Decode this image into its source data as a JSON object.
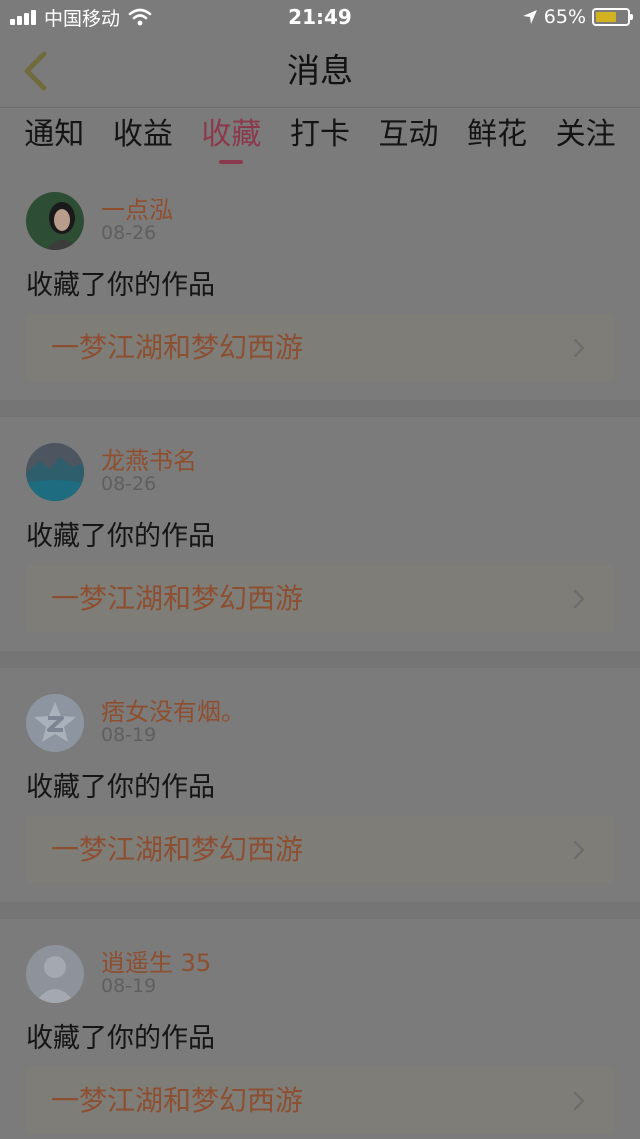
{
  "status_bar": {
    "carrier": "中国移动",
    "time": "21:49",
    "battery": "65%"
  },
  "nav": {
    "title": "消息"
  },
  "tabs": [
    {
      "label": "通知",
      "active": false
    },
    {
      "label": "收益",
      "active": false
    },
    {
      "label": "收藏",
      "active": true
    },
    {
      "label": "打卡",
      "active": false
    },
    {
      "label": "互动",
      "active": false
    },
    {
      "label": "鲜花",
      "active": false
    },
    {
      "label": "关注",
      "active": false
    }
  ],
  "items": [
    {
      "user": "一点泓",
      "date": "08-26",
      "action": "收藏了你的作品",
      "work": "一梦江湖和梦幻西游"
    },
    {
      "user": "龙燕书名",
      "date": "08-26",
      "action": "收藏了你的作品",
      "work": "一梦江湖和梦幻西游"
    },
    {
      "user": "痞女没有烟。",
      "date": "08-19",
      "action": "收藏了你的作品",
      "work": "一梦江湖和梦幻西游"
    },
    {
      "user": "逍遥生 35",
      "date": "08-19",
      "action": "收藏了你的作品",
      "work": "一梦江湖和梦幻西游"
    }
  ],
  "colors": {
    "accent": "#8a3a4c",
    "username": "#8f4f2f",
    "overlay": "#7b7b7b"
  }
}
